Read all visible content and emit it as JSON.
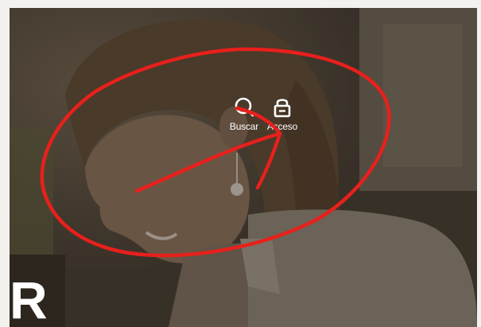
{
  "header": {
    "search_label": "Buscar",
    "login_label": "Acceso"
  },
  "hero": {
    "brand_letter": "R"
  },
  "colors": {
    "overlay_dark": "#3d362e",
    "icon_white": "#ffffff",
    "annotation_red": "#e8201c"
  },
  "icons": {
    "search": "search-icon",
    "login": "lock-icon"
  }
}
